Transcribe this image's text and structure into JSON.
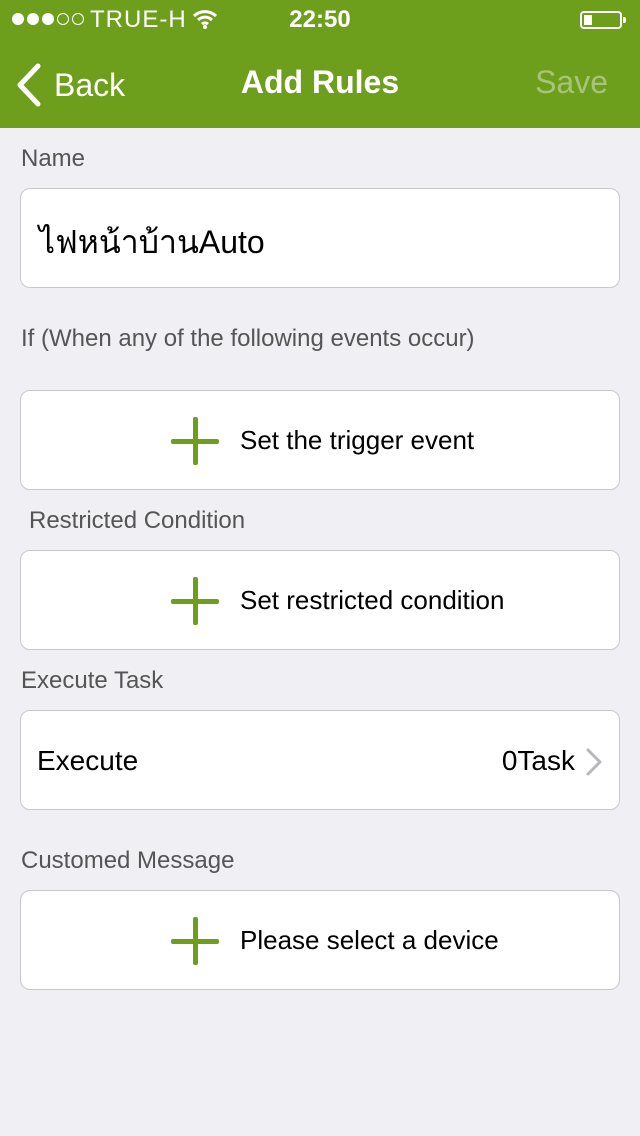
{
  "status_bar": {
    "carrier": "TRUE-H",
    "time": "22:50",
    "signal_bars_filled": 3,
    "signal_bars_total": 5,
    "battery_level": 0.2
  },
  "nav": {
    "back_label": "Back",
    "title": "Add Rules",
    "save_label": "Save",
    "icons": {
      "back": "chevron-left-icon"
    }
  },
  "name_section": {
    "label": "Name",
    "value": "ไฟหน้าบ้านAuto"
  },
  "if_section": {
    "label": "If (When any of the following events occur)",
    "button": "Set the trigger event"
  },
  "restricted_section": {
    "label": "Restricted Condition",
    "button": "Set restricted condition"
  },
  "execute_section": {
    "label": "Execute Task",
    "row_label": "Execute",
    "row_value": "0Task"
  },
  "message_section": {
    "label": "Customed Message",
    "button": "Please select a device"
  },
  "colors": {
    "header": "#6e9f1c",
    "accent": "#6e9f1c",
    "background": "#efeff4",
    "save_disabled": "#a8c47a"
  }
}
